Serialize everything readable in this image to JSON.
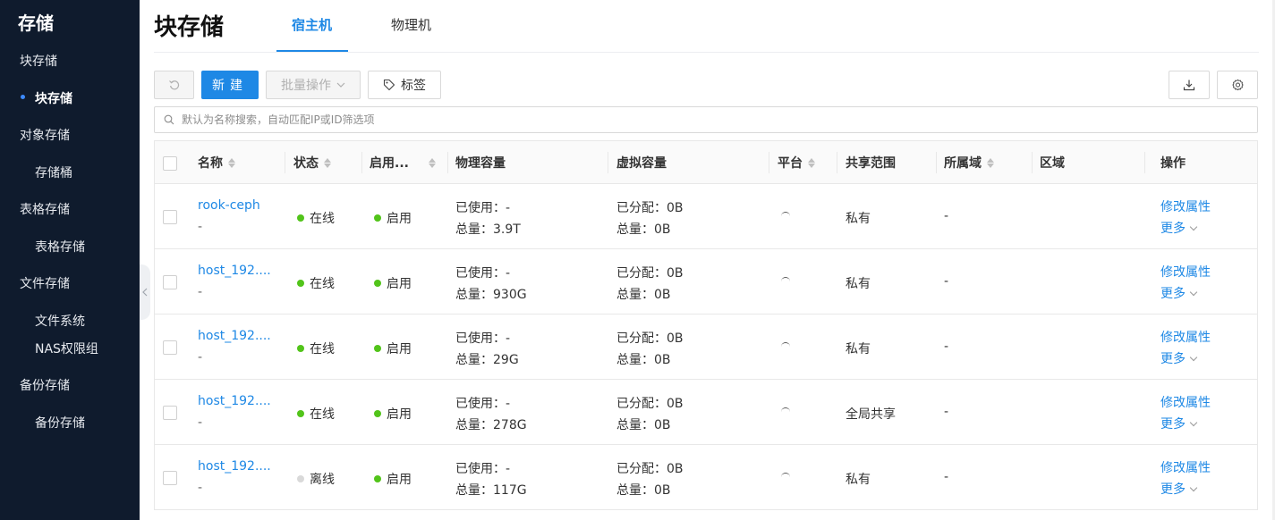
{
  "sidebar": {
    "title": "存储",
    "items": [
      {
        "label": "块存储",
        "type": "group"
      },
      {
        "label": "块存储",
        "type": "sub",
        "active": true
      },
      {
        "label": "对象存储",
        "type": "group"
      },
      {
        "label": "存储桶",
        "type": "sub"
      },
      {
        "label": "表格存储",
        "type": "group"
      },
      {
        "label": "表格存储",
        "type": "sub"
      },
      {
        "label": "文件存储",
        "type": "group"
      },
      {
        "label": "文件系统",
        "type": "sub"
      },
      {
        "label": "NAS权限组",
        "type": "sub"
      },
      {
        "label": "备份存储",
        "type": "group"
      },
      {
        "label": "备份存储",
        "type": "sub"
      }
    ]
  },
  "header": {
    "title": "块存储",
    "tabs": [
      {
        "label": "宿主机",
        "active": true
      },
      {
        "label": "物理机",
        "active": false
      }
    ]
  },
  "toolbar": {
    "refresh_icon": "refresh-icon",
    "new_label": "新建",
    "batch_label": "批量操作",
    "tag_label": "标签",
    "download_icon": "download-icon",
    "settings_icon": "gear-icon"
  },
  "search": {
    "placeholder": "默认为名称搜索，自动匹配IP或ID筛选项"
  },
  "table": {
    "columns": [
      "名称",
      "状态",
      "启用...",
      "物理容量",
      "虚拟容量",
      "平台",
      "共享范围",
      "所属域",
      "区域",
      "操作"
    ],
    "rows": [
      {
        "name": "rook-ceph",
        "sub": "-",
        "status": "在线",
        "online": true,
        "enabled": "启用",
        "phys_used": "已使用：-",
        "phys_total": "总量：3.9T",
        "virt_alloc": "已分配：0B",
        "virt_total": "总量：0B",
        "share": "私有",
        "domain": "-",
        "edit": "修改属性",
        "more": "更多"
      },
      {
        "name": "host_192....",
        "sub": "-",
        "status": "在线",
        "online": true,
        "enabled": "启用",
        "phys_used": "已使用：-",
        "phys_total": "总量：930G",
        "virt_alloc": "已分配：0B",
        "virt_total": "总量：0B",
        "share": "私有",
        "domain": "-",
        "edit": "修改属性",
        "more": "更多"
      },
      {
        "name": "host_192....",
        "sub": "-",
        "status": "在线",
        "online": true,
        "enabled": "启用",
        "phys_used": "已使用：-",
        "phys_total": "总量：29G",
        "virt_alloc": "已分配：0B",
        "virt_total": "总量：0B",
        "share": "私有",
        "domain": "-",
        "edit": "修改属性",
        "more": "更多"
      },
      {
        "name": "host_192....",
        "sub": "-",
        "status": "在线",
        "online": true,
        "enabled": "启用",
        "phys_used": "已使用：-",
        "phys_total": "总量：278G",
        "virt_alloc": "已分配：0B",
        "virt_total": "总量：0B",
        "share": "全局共享",
        "domain": "-",
        "edit": "修改属性",
        "more": "更多"
      },
      {
        "name": "host_192....",
        "sub": "-",
        "status": "离线",
        "online": false,
        "enabled": "启用",
        "phys_used": "已使用：-",
        "phys_total": "总量：117G",
        "virt_alloc": "已分配：0B",
        "virt_total": "总量：0B",
        "share": "私有",
        "domain": "-",
        "edit": "修改属性",
        "more": "更多"
      }
    ]
  },
  "colors": {
    "sidebar_bg": "#0f1b2d",
    "accent": "#1e88e5",
    "online": "#52c41a",
    "offline": "#d9d9d9"
  }
}
